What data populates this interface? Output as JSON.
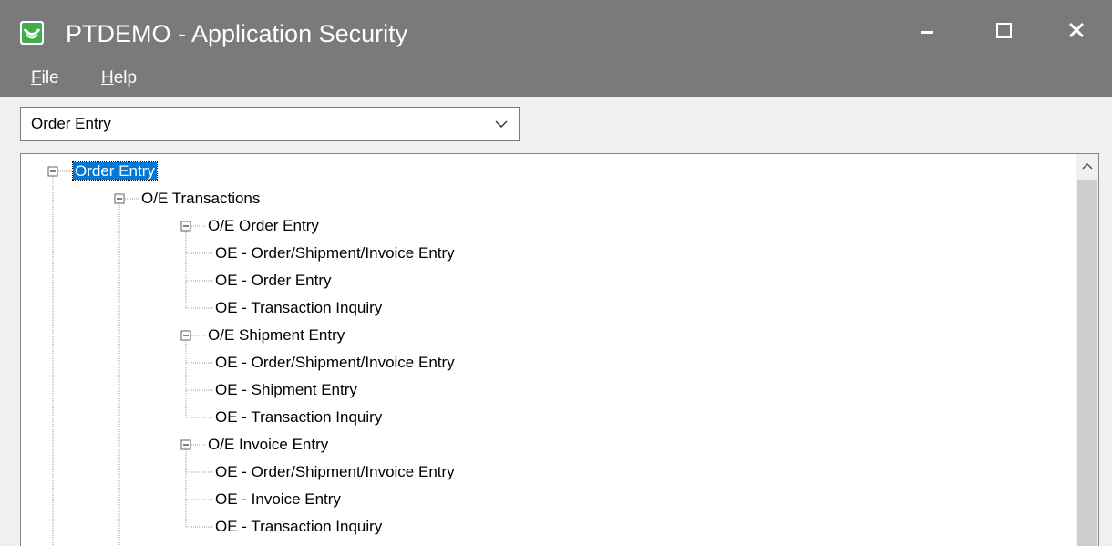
{
  "window": {
    "title": "PTDEMO - Application Security",
    "controls": [
      "minimize",
      "maximize",
      "close"
    ]
  },
  "menu": {
    "file": {
      "mnemonic": "F",
      "rest": "ile"
    },
    "help": {
      "mnemonic": "H",
      "rest": "elp"
    }
  },
  "module_select": {
    "value": "Order Entry"
  },
  "tree": {
    "nodes": [
      {
        "label": "Order Entry",
        "level": 0,
        "expanded": true,
        "selected": true
      },
      {
        "label": "O/E Transactions",
        "level": 1,
        "expanded": true
      },
      {
        "label": "O/E Order Entry",
        "level": 2,
        "expanded": true
      },
      {
        "label": "OE - Order/Shipment/Invoice Entry",
        "level": 3
      },
      {
        "label": "OE - Order Entry",
        "level": 3
      },
      {
        "label": "OE - Transaction Inquiry",
        "level": 3
      },
      {
        "label": "O/E Shipment Entry",
        "level": 2,
        "expanded": true
      },
      {
        "label": "OE - Order/Shipment/Invoice Entry",
        "level": 3
      },
      {
        "label": "OE - Shipment Entry",
        "level": 3
      },
      {
        "label": "OE - Transaction Inquiry",
        "level": 3
      },
      {
        "label": "O/E Invoice Entry",
        "level": 2,
        "expanded": true
      },
      {
        "label": "OE - Order/Shipment/Invoice Entry",
        "level": 3
      },
      {
        "label": "OE - Invoice Entry",
        "level": 3
      },
      {
        "label": "OE - Transaction Inquiry",
        "level": 3
      }
    ]
  },
  "colors": {
    "titlebar": "#7a7a7a",
    "selection": "#0078d7",
    "app_icon": "#3fae49"
  }
}
